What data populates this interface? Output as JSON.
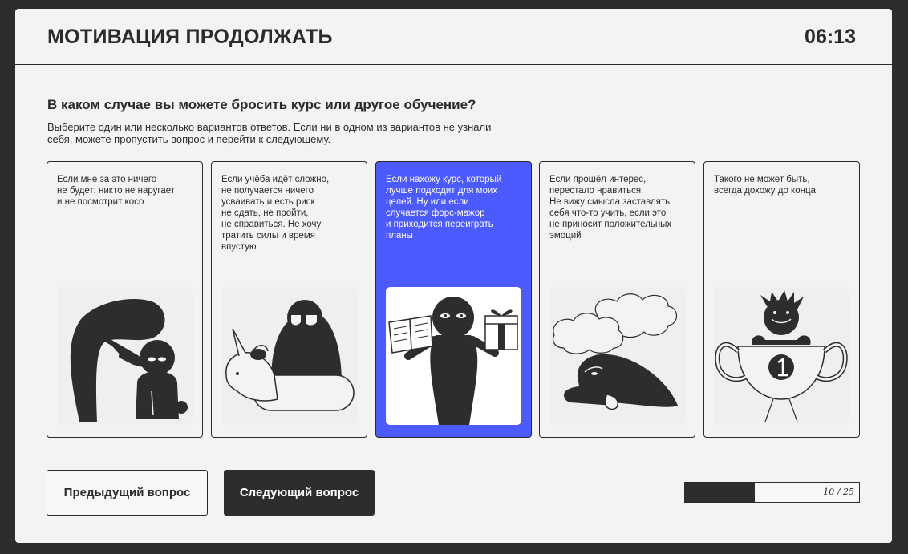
{
  "header": {
    "title": "МОТИВАЦИЯ ПРОДОЛЖАТЬ",
    "timer": "06:13"
  },
  "question": {
    "title": "В каком случае вы можете бросить курс или другое обучение?",
    "hint": "Выберите один или несколько вариантов ответов. Если ни в одном из вариантов не узнали себя, можете пропустить вопрос и перейти к следующему."
  },
  "options": [
    {
      "text": "Если мне за это ничего\nне будет: никто не наругает\nи не посмотрит косо",
      "selected": false,
      "illustration": "scolding-figure-icon"
    },
    {
      "text": "Если учёба идёт сложно,\nне получается ничего\nусваивать и есть риск\nне сдать, не пройти,\nне справиться. Не хочу\nтратить силы и время\nвпустую",
      "selected": false,
      "illustration": "unicorn-figure-icon"
    },
    {
      "text": "Если нахожу курс, который\nлучше подходит для моих\nцелей. Ну или если\nслучается форс-мажор\nи приходится переиграть\nпланы",
      "selected": true,
      "illustration": "book-and-gift-figure-icon"
    },
    {
      "text": "Если прошёл интерес,\nперестало нравиться.\nНе вижу смысла заставлять\nсебя что-то учить, если это\nне приносит положительных\nэмоций",
      "selected": false,
      "illustration": "bored-figure-clouds-icon"
    },
    {
      "text": "Такого не может быть,\nвсегда дохожу до конца",
      "selected": false,
      "illustration": "trophy-figure-icon"
    }
  ],
  "buttons": {
    "prev": "Предыдущий вопрос",
    "next": "Следующий вопрос"
  },
  "progress": {
    "current": 10,
    "total": 25,
    "label": "10 / 25"
  },
  "colors": {
    "selected": "#4b5bff",
    "dark": "#2d2d2d",
    "panel": "#f3f3f3"
  }
}
